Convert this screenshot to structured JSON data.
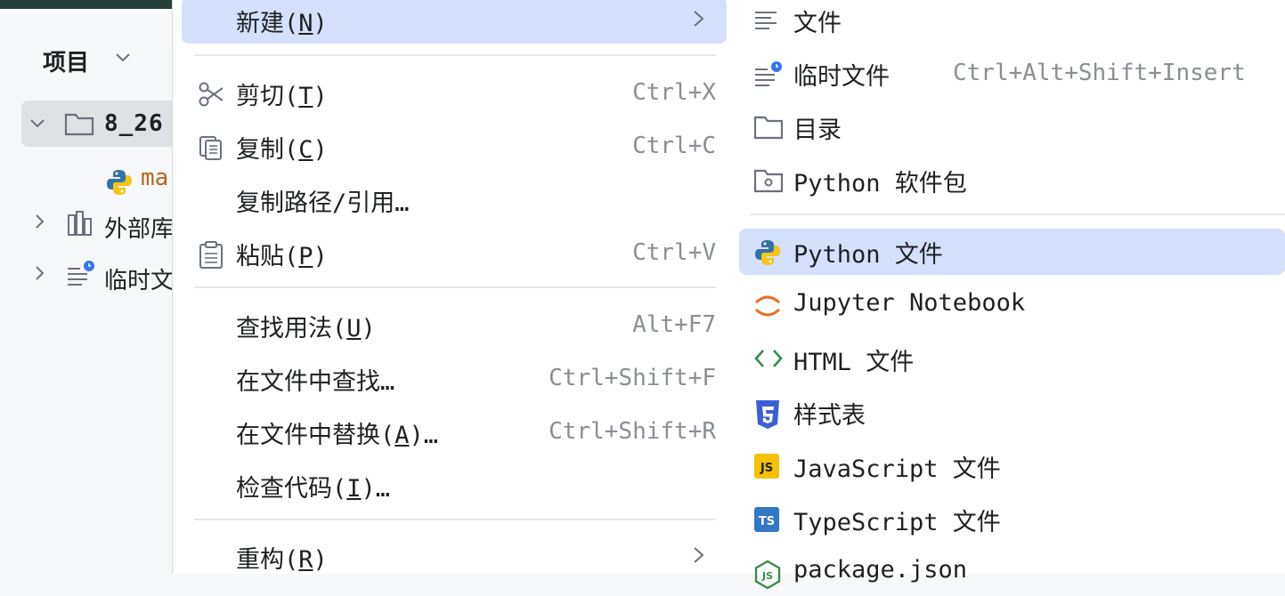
{
  "project_panel": {
    "title": "项目",
    "tree": [
      {
        "label": "8_26",
        "icon": "folder-icon",
        "expanded": true
      },
      {
        "label": "ma",
        "icon": "python-icon"
      },
      {
        "label": "外部库",
        "icon": "library-icon",
        "expanded": false
      },
      {
        "label": "临时文",
        "icon": "scratch-icon",
        "expanded": false
      }
    ]
  },
  "context_menu": {
    "new": {
      "text": "新建(",
      "mnemonic": "N",
      "close": ")"
    },
    "cut": {
      "text": "剪切(",
      "mnemonic": "T",
      "close": ")",
      "shortcut": "Ctrl+X"
    },
    "copy": {
      "text": "复制(",
      "mnemonic": "C",
      "close": ")",
      "shortcut": "Ctrl+C"
    },
    "copy_path": {
      "text": "复制路径/引用…"
    },
    "paste": {
      "text": "粘贴(",
      "mnemonic": "P",
      "close": ")",
      "shortcut": "Ctrl+V"
    },
    "find_usages": {
      "text": "查找用法(",
      "mnemonic": "U",
      "close": ")",
      "shortcut": "Alt+F7"
    },
    "find_in_files": {
      "text": "在文件中查找…",
      "shortcut": "Ctrl+Shift+F"
    },
    "replace_in_files": {
      "text": "在文件中替换(",
      "mnemonic": "A",
      "close": ")…",
      "shortcut": "Ctrl+Shift+R"
    },
    "inspect_code": {
      "text": "检查代码(",
      "mnemonic": "I",
      "close": ")…"
    },
    "refactor": {
      "text": "重构(",
      "mnemonic": "R",
      "close": ")"
    }
  },
  "submenu": {
    "file": "文件",
    "scratch_file": {
      "label": "临时文件",
      "shortcut": "Ctrl+Alt+Shift+Insert"
    },
    "directory": "目录",
    "python_package": "Python 软件包",
    "python_file": "Python 文件",
    "jupyter": "Jupyter Notebook",
    "html_file": "HTML 文件",
    "stylesheet": "样式表",
    "javascript_file": "JavaScript 文件",
    "typescript_file": "TypeScript 文件",
    "package_json": "package.json"
  },
  "colors": {
    "highlight": "#d4e0fc",
    "shortcut_text": "#8b8e94",
    "css_badge": "#3b5fd6",
    "js_badge": "#f5c000",
    "ts_badge": "#3178c6",
    "jupyter_orange": "#e8712b",
    "html_green": "#3d8a4e"
  }
}
